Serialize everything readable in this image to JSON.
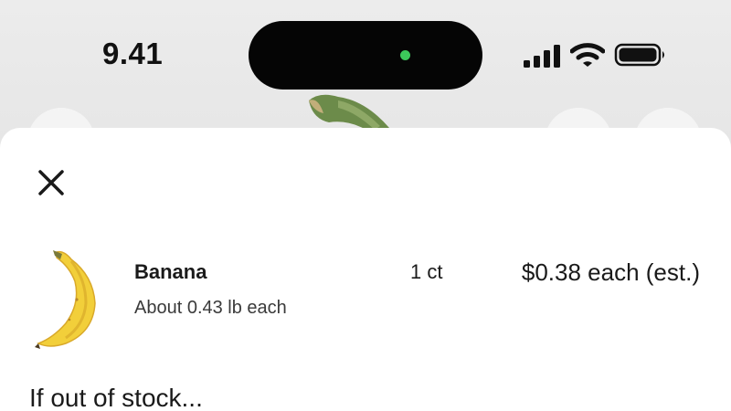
{
  "status_bar": {
    "time": "9.41"
  },
  "item": {
    "name": "Banana",
    "subtitle": "About 0.43 lb each",
    "quantity": "1 ct",
    "price": "$0.38 each (est.)",
    "image_icon": "banana-image"
  },
  "section": {
    "title": "If out of stock..."
  },
  "icons": {
    "close": "close-icon",
    "signal": "cellular-signal-icon",
    "wifi": "wifi-icon",
    "battery": "battery-icon"
  },
  "colors": {
    "banana_yellow": "#f2cf3a",
    "camera_dot": "#3cc85a",
    "sheet_bg": "#ffffff"
  }
}
